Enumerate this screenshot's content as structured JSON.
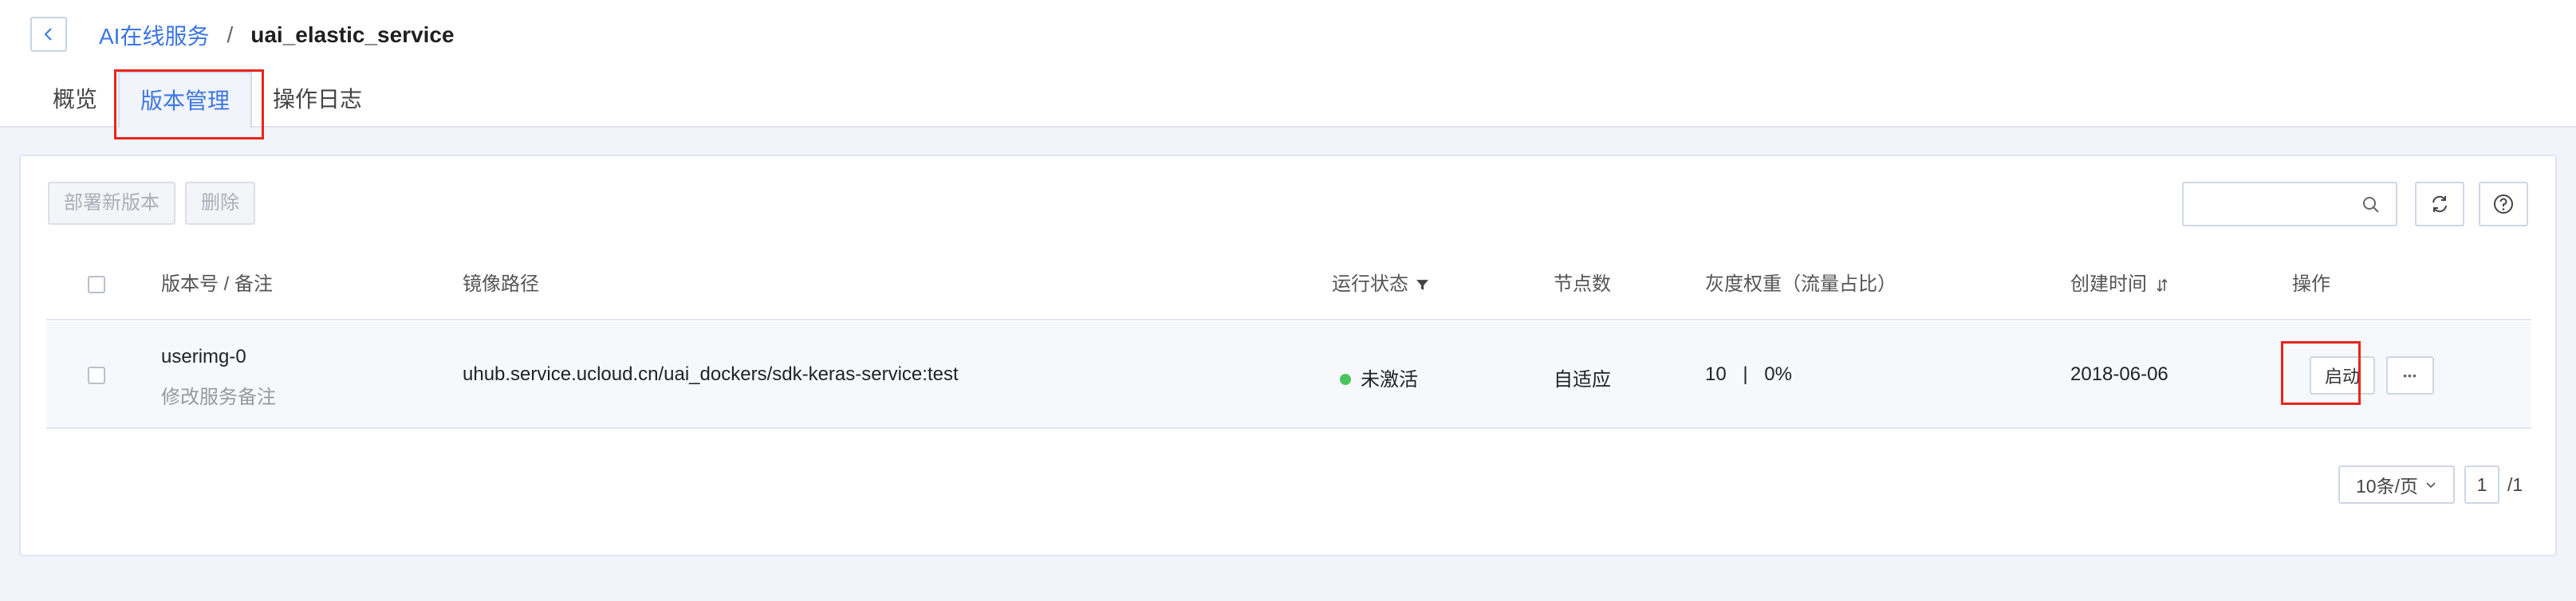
{
  "breadcrumb": {
    "parent": "AI在线服务",
    "separator": "/",
    "current": "uai_elastic_service"
  },
  "tabs": [
    {
      "label": "概览"
    },
    {
      "label": "版本管理",
      "active": true
    },
    {
      "label": "操作日志"
    }
  ],
  "toolbar": {
    "deploy_label": "部署新版本",
    "delete_label": "删除",
    "search_placeholder": ""
  },
  "table": {
    "headers": {
      "version": "版本号 / 备注",
      "image": "镜像路径",
      "status": "运行状态",
      "nodes": "节点数",
      "weight": "灰度权重（流量占比）",
      "created": "创建时间",
      "actions": "操作"
    },
    "rows": [
      {
        "version": "userimg-0",
        "remark": "修改服务备注",
        "image": "uhub.service.ucloud.cn/uai_dockers/sdk-keras-service:test",
        "status": "未激活",
        "nodes": "自适应",
        "weight_value": "10",
        "weight_sep": "|",
        "weight_percent": "0%",
        "created": "2018-06-06",
        "start_label": "启动",
        "more_label": "•••"
      }
    ]
  },
  "pagination": {
    "page_size": "10条/页",
    "current_page": "1",
    "total": "/1"
  },
  "colors": {
    "accent": "#3b76e1",
    "status_dot": "#4ac55d",
    "highlight": "#e8251c"
  }
}
